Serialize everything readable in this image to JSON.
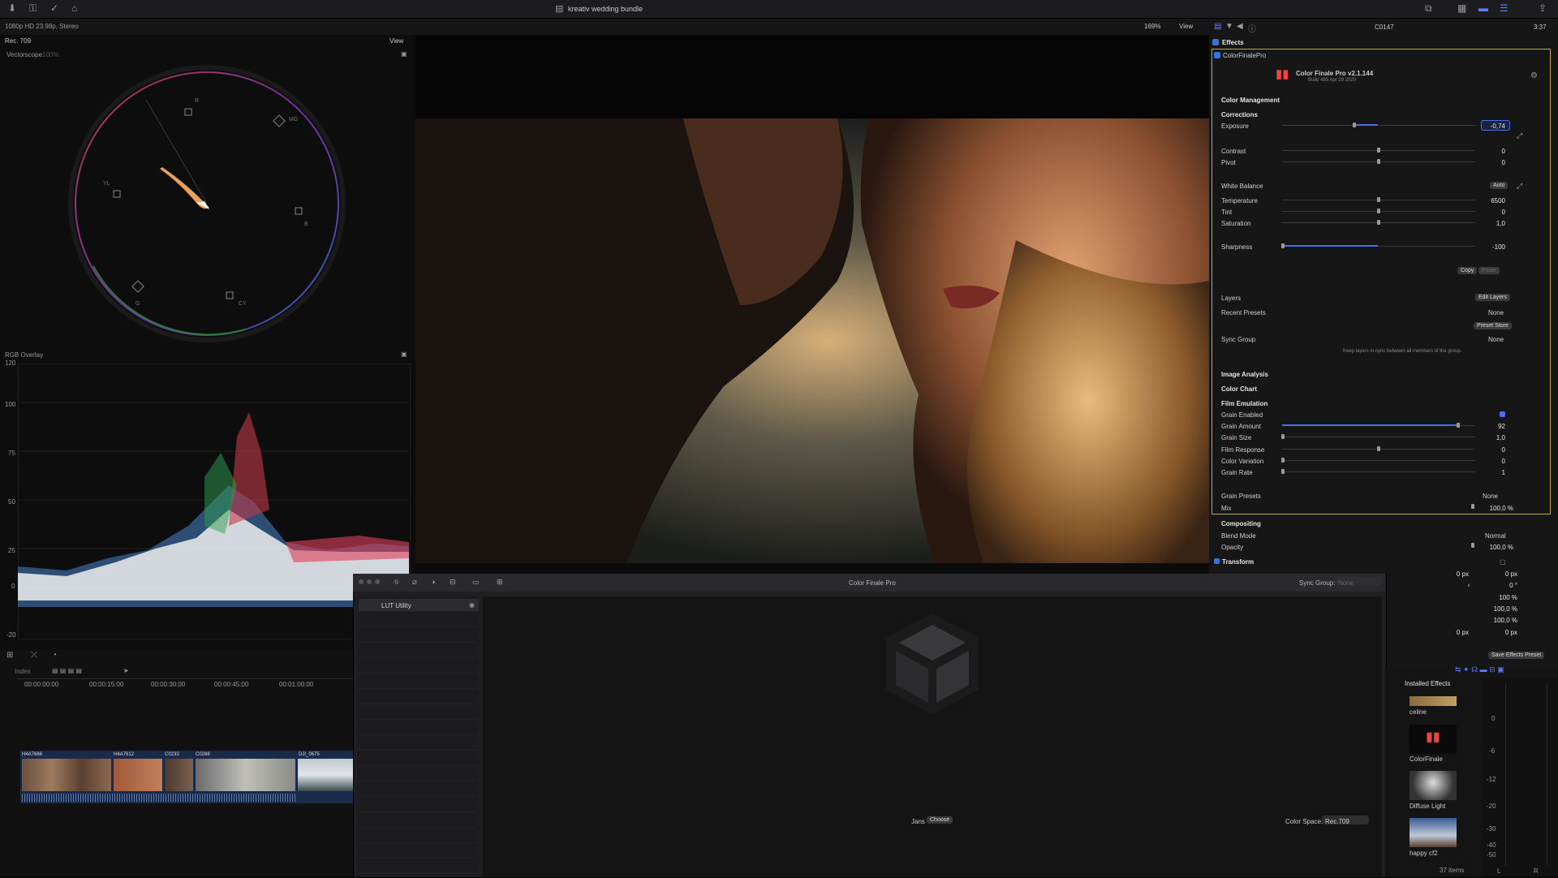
{
  "toolbar": {
    "project_name": "kreativ wedding bundle"
  },
  "viewer_info": {
    "format": "1080p HD 23.98p, Stereo",
    "zoom": "169%",
    "view": "View",
    "view_left": "View",
    "color_space": "Rec. 709"
  },
  "clip_name": "C0147",
  "timecode": "3:37",
  "scopes": {
    "vectorscope_label": "Vectorscope",
    "vectorscope_pct": "100%",
    "targets": [
      "R",
      "MG",
      "B",
      "CY",
      "G",
      "YL"
    ],
    "rgb_overlay_label": "RGB Overlay",
    "y_ticks": [
      "120",
      "100",
      "75",
      "50",
      "25",
      "0",
      "-20"
    ]
  },
  "inspector": {
    "effects_label": "Effects",
    "plugin_label": "ColorFinalePro",
    "plugin_title": "Color Finale Pro v2.1.144",
    "plugin_build": "Build 495 Apr 29 2020",
    "color_management": "Color Management",
    "corrections": "Corrections",
    "exposure": {
      "label": "Exposure",
      "value": "-0,74"
    },
    "contrast": {
      "label": "Contrast",
      "value": "0"
    },
    "pivot": {
      "label": "Pivot",
      "value": "0"
    },
    "white_balance": {
      "label": "White Balance",
      "auto": "Auto"
    },
    "temperature": {
      "label": "Temperature",
      "value": "6500"
    },
    "tint": {
      "label": "Tint",
      "value": "0"
    },
    "saturation": {
      "label": "Saturation",
      "value": "1,0"
    },
    "sharpness": {
      "label": "Sharpness",
      "value": "-100"
    },
    "copy": "Copy",
    "paste": "Paste",
    "layers": "Layers",
    "edit_layers": "Edit Layers",
    "recent_presets": "Recent Presets",
    "recent_presets_value": "None",
    "preset_store": "Preset Store",
    "sync_group": "Sync Group",
    "sync_group_value": "None",
    "sync_note": "Keep layers in-sync between all members of the group.",
    "image_analysis": "Image Analysis",
    "color_chart": "Color Chart",
    "film_emulation": "Film Emulation",
    "grain_enabled": "Grain Enabled",
    "grain_amount": {
      "label": "Grain Amount",
      "value": "92"
    },
    "grain_size": {
      "label": "Grain Size",
      "value": "1,0"
    },
    "film_response": {
      "label": "Film Response",
      "value": "0"
    },
    "color_variation": {
      "label": "Color Variation",
      "value": "0"
    },
    "grain_rate": {
      "label": "Grain Rate",
      "value": "1"
    },
    "grain_presets": "Grain Presets",
    "grain_presets_value": "None",
    "mix": {
      "label": "Mix",
      "value": "100,0 %"
    },
    "compositing": "Compositing",
    "blend_mode": {
      "label": "Blend Mode",
      "value": "Normal"
    },
    "opacity": {
      "label": "Opacity",
      "value": "100,0 %"
    },
    "transform": "Transform",
    "transform_values": [
      "0 px",
      "0 px",
      "0 °",
      "100 %",
      "100,0 %",
      "100,0 %",
      "0 px",
      "0 px"
    ],
    "save_preset": "Save Effects Preset"
  },
  "cfp_window": {
    "title": "Color Finale Pro",
    "sync_group_label": "Sync Group:",
    "sync_group_value": "None",
    "layer_name": "LUT Utility",
    "lut_label": "Jans",
    "choose": "Choose",
    "color_space_label": "Color Space:",
    "color_space_value": "Rec.709"
  },
  "timeline": {
    "index": "Index",
    "timecodes": [
      "00:00:00:00",
      "00:00:15:00",
      "00:00:30:00",
      "00:00:45:00",
      "00:01:00:00"
    ],
    "clips": [
      "H4A7666",
      "H4A7612",
      "C0233",
      "C0288",
      "DJI_0675"
    ]
  },
  "effects_browser": {
    "title": "Installed Effects",
    "items": [
      "celine",
      "ColorFinale",
      "Diffuse Light",
      "happy cf2"
    ],
    "count": "37 items"
  },
  "audio_meter": {
    "ticks": [
      "0",
      "-6",
      "-12",
      "-20",
      "-30",
      "-40",
      "-50"
    ],
    "l": "L",
    "r": "R"
  }
}
